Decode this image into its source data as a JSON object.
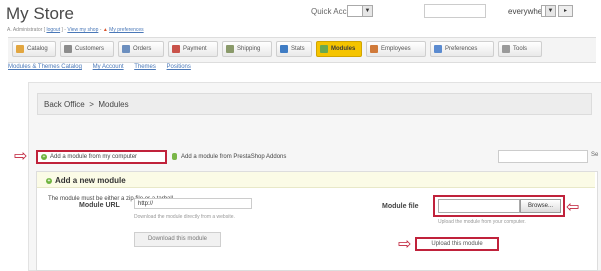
{
  "header": {
    "store_title": "My Store",
    "admin_user": "A. Administrator",
    "logout": "logout",
    "view_shop": "View my shop",
    "preferences": "My preferences",
    "quick_access": "Quick Access",
    "search_scope": "everywhere"
  },
  "tabs": [
    {
      "label": "Catalog",
      "icon": "book-icon",
      "color": "#e2a640"
    },
    {
      "label": "Customers",
      "icon": "customers-icon",
      "color": "#8c8c8c"
    },
    {
      "label": "Orders",
      "icon": "cart-icon",
      "color": "#6c8fbf"
    },
    {
      "label": "Payment",
      "icon": "payment-icon",
      "color": "#c9524a"
    },
    {
      "label": "Shipping",
      "icon": "truck-icon",
      "color": "#8a9a6a"
    },
    {
      "label": "Stats",
      "icon": "chart-icon",
      "color": "#3f7cc4"
    },
    {
      "label": "Modules",
      "icon": "puzzle-icon",
      "color": "#6aa84f",
      "active": true
    },
    {
      "label": "Employees",
      "icon": "employees-icon",
      "color": "#d07a3a"
    },
    {
      "label": "Preferences",
      "icon": "window-icon",
      "color": "#5b8bd0"
    },
    {
      "label": "Tools",
      "icon": "wrench-icon",
      "color": "#9a9a9a"
    }
  ],
  "subnav": [
    "Modules & Themes Catalog",
    "My Account",
    "Themes",
    "Positions"
  ],
  "breadcrumb": {
    "home": "Back Office",
    "sep": ">",
    "current": "Modules"
  },
  "actions": {
    "add_from_computer": "Add a module from my computer",
    "add_from_addons": "Add a module from PrestaShop Addons",
    "search_button": "Se"
  },
  "add_module": {
    "title": "Add a new module",
    "description": "The module must be either a zip file or a tarball.",
    "url_label": "Module URL",
    "url_value": "http://",
    "url_hint": "Download the module directly from a website.",
    "download_button": "Download this module",
    "file_label": "Module file",
    "browse_button": "Browse...",
    "file_hint": "Upload the module from your computer.",
    "upload_button": "Upload this module"
  },
  "colors": {
    "annotation_red": "#c0223b",
    "active_tab": "#f5c400"
  }
}
